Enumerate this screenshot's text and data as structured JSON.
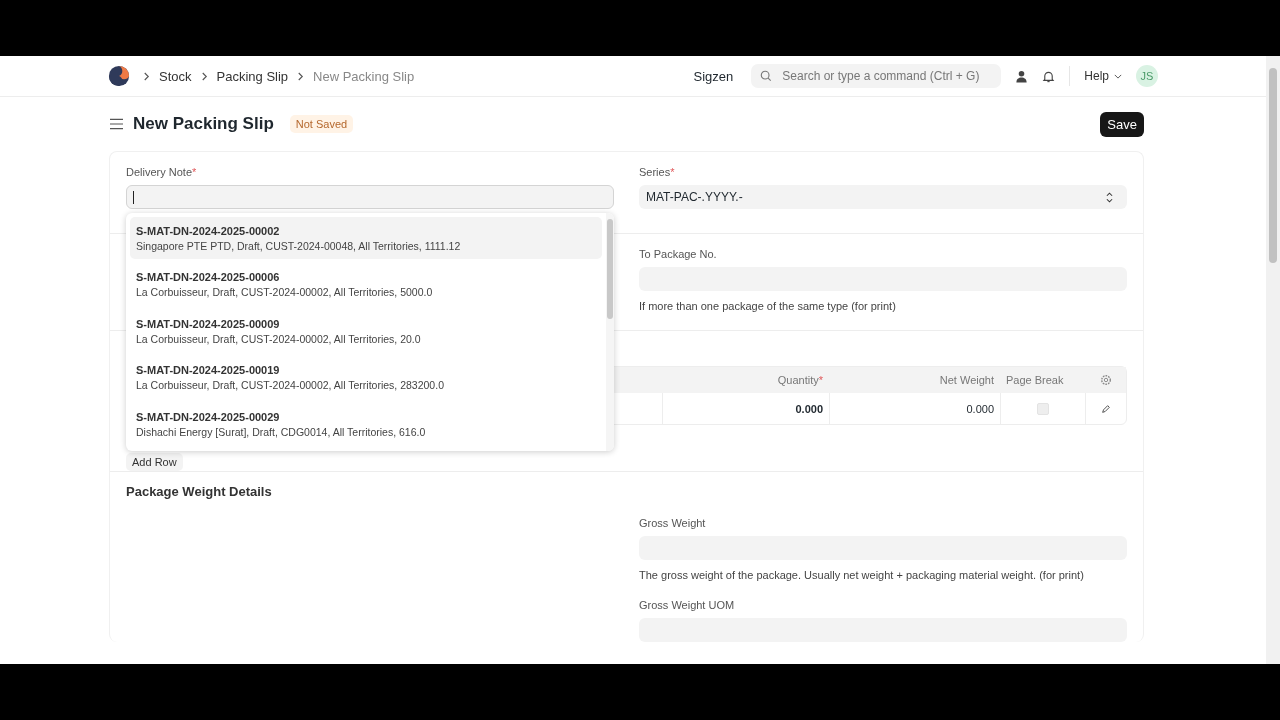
{
  "breadcrumbs": [
    {
      "label": "Stock",
      "current": false
    },
    {
      "label": "Packing Slip",
      "current": false
    },
    {
      "label": "New Packing Slip",
      "current": true
    }
  ],
  "navbar": {
    "company": "Sigzen",
    "search_placeholder": "Search or type a command (Ctrl + G)",
    "help": "Help",
    "avatar": "JS"
  },
  "page": {
    "title": "New Packing Slip",
    "status": "Not Saved",
    "save": "Save"
  },
  "delivery_note": {
    "label": "Delivery Note",
    "required_mark": "*"
  },
  "series": {
    "label": "Series",
    "required_mark": "*",
    "value": "MAT-PAC-.YYYY.-"
  },
  "dropdown": {
    "items": [
      {
        "title": "S-MAT-DN-2024-2025-00002",
        "description": "Singapore PTE PTD, Draft, CUST-2024-00048, All Territories, 1111.12",
        "selected": true
      },
      {
        "title": "S-MAT-DN-2024-2025-00006",
        "description": "La Corbuisseur, Draft, CUST-2024-00002, All Territories, 5000.0",
        "selected": false
      },
      {
        "title": "S-MAT-DN-2024-2025-00009",
        "description": "La Corbuisseur, Draft, CUST-2024-00002, All Territories, 20.0",
        "selected": false
      },
      {
        "title": "S-MAT-DN-2024-2025-00019",
        "description": "La Corbuisseur, Draft, CUST-2024-00002, All Territories, 283200.0",
        "selected": false
      },
      {
        "title": "S-MAT-DN-2024-2025-00029",
        "description": "Dishachi Energy [Surat], Draft, CDG0014, All Territories, 616.0",
        "selected": false
      }
    ]
  },
  "to_package": {
    "label": "To Package No.",
    "description": "If more than one package of the same type (for print)"
  },
  "items_table": {
    "columns": [
      {
        "label": "Quantity",
        "required_mark": "*"
      },
      {
        "label": "Net Weight"
      },
      {
        "label": "Page Break"
      }
    ],
    "rows": [
      {
        "quantity": "0.000",
        "net_weight": "0.000",
        "page_break": false
      }
    ],
    "add_row": "Add Row"
  },
  "weight_section": {
    "title": "Package Weight Details",
    "fields": [
      {
        "label": "Gross Weight",
        "description": "The gross weight of the package. Usually net weight + packaging material weight. (for print)"
      },
      {
        "label": "Gross Weight UOM"
      }
    ]
  }
}
